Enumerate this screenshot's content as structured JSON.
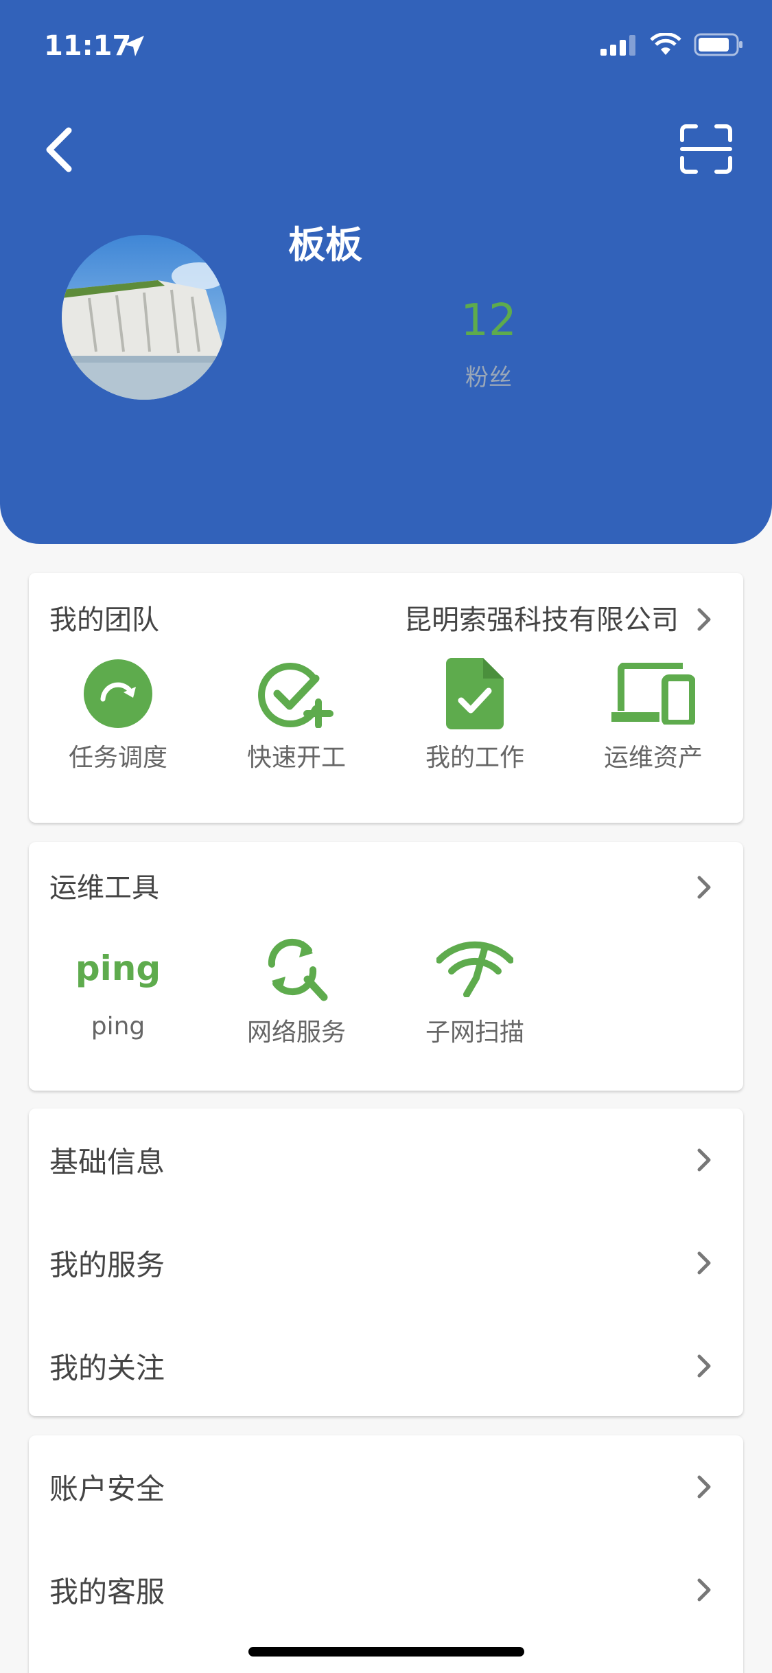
{
  "status": {
    "time": "11:17"
  },
  "profile": {
    "name": "板板",
    "fans_count": "12",
    "fans_label": "粉丝"
  },
  "team": {
    "title": "我的团队",
    "company": "昆明索强科技有限公司",
    "items": [
      {
        "label": "任务调度",
        "icon": "task-dispatch-icon"
      },
      {
        "label": "快速开工",
        "icon": "quick-start-icon"
      },
      {
        "label": "我的工作",
        "icon": "my-work-icon"
      },
      {
        "label": "运维资产",
        "icon": "ops-assets-icon"
      }
    ]
  },
  "tools": {
    "title": "运维工具",
    "items": [
      {
        "label": "ping",
        "icon": "ping-icon",
        "icon_text": "ping"
      },
      {
        "label": "网络服务",
        "icon": "network-service-icon"
      },
      {
        "label": "子网扫描",
        "icon": "subnet-scan-icon"
      }
    ]
  },
  "menu1": [
    {
      "label": "基础信息"
    },
    {
      "label": "我的服务"
    },
    {
      "label": "我的关注"
    }
  ],
  "menu2": [
    {
      "label": "账户安全"
    },
    {
      "label": "我的客服"
    }
  ],
  "colors": {
    "header": "#3262ba",
    "accent": "#5eab4d",
    "background": "#f7f7f7"
  }
}
